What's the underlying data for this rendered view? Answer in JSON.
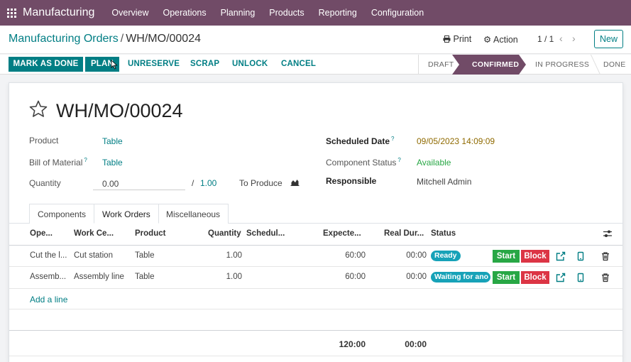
{
  "navbar": {
    "app_name": "Manufacturing",
    "menu": [
      "Overview",
      "Operations",
      "Planning",
      "Products",
      "Reporting",
      "Configuration"
    ]
  },
  "control_panel": {
    "breadcrumb_parent": "Manufacturing Orders",
    "breadcrumb_sep": "/",
    "breadcrumb_current": "WH/MO/00024",
    "print_label": "Print",
    "action_label": "Action",
    "pager": "1 / 1",
    "new_label": "New"
  },
  "statusbar": {
    "buttons": [
      "MARK AS DONE",
      "PLAN",
      "UNRESERVE",
      "SCRAP",
      "UNLOCK",
      "CANCEL"
    ],
    "stages": [
      "DRAFT",
      "CONFIRMED",
      "IN PROGRESS",
      "DONE"
    ],
    "active_stage": "CONFIRMED"
  },
  "form": {
    "title": "WH/MO/00024",
    "product_label": "Product",
    "product_value": "Table",
    "bom_label": "Bill of Material",
    "bom_value": "Table",
    "quantity_label": "Quantity",
    "quantity_value": "0.00",
    "quantity_sep": "/",
    "quantity_target": "1.00",
    "to_produce_label": "To Produce",
    "scheduled_date_label": "Scheduled Date",
    "scheduled_date_value": "09/05/2023 14:09:09",
    "component_status_label": "Component Status",
    "component_status_value": "Available",
    "responsible_label": "Responsible",
    "responsible_value": "Mitchell Admin",
    "help_mark": "?"
  },
  "tabs": [
    "Components",
    "Work Orders",
    "Miscellaneous"
  ],
  "active_tab": "Work Orders",
  "table": {
    "columns": [
      "Ope...",
      "Work Ce...",
      "Product",
      "Quantity",
      "Schedul...",
      "Expecte...",
      "Real Dur...",
      "Status"
    ],
    "rows": [
      {
        "operation": "Cut the l...",
        "work_center": "Cut station",
        "product": "Table",
        "quantity": "1.00",
        "expected": "60:00",
        "real": "00:00",
        "status": "Ready"
      },
      {
        "operation": "Assemb...",
        "work_center": "Assembly line",
        "product": "Table",
        "quantity": "1.00",
        "expected": "60:00",
        "real": "00:00",
        "status": "Waiting for ano"
      }
    ],
    "start_label": "Start",
    "block_label": "Block",
    "add_line": "Add a line",
    "total_expected": "120:00",
    "total_real": "00:00"
  },
  "colors": {
    "brand": "#714b67",
    "primary": "#017e84",
    "start": "#28a745",
    "block": "#dc3545",
    "status_badge": "#17a2b8"
  }
}
